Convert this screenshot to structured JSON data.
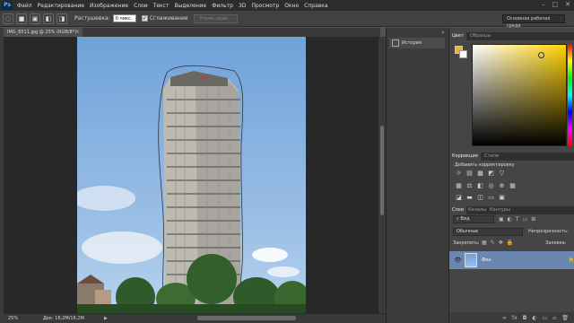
{
  "menu": {
    "logo": "Ps",
    "items": [
      "Файл",
      "Редактирование",
      "Изображение",
      "Слои",
      "Текст",
      "Выделение",
      "Фильтр",
      "3D",
      "Просмотр",
      "Окно",
      "Справка"
    ]
  },
  "options": {
    "feather_label": "Растушевка:",
    "feather_value": "0 пикс.",
    "antialias_label": "Сглаживание",
    "antialias_checked": true,
    "refine_edge": "Уточн. край...",
    "workspace": "Основная рабочая среда"
  },
  "document": {
    "tab_title": "IMG_8511.jpg @ 25% (RGB/8*)",
    "zoom": "25%",
    "doc_size": "Док: 16,2M/16,2M"
  },
  "history_panel": {
    "label": "История"
  },
  "color_panel": {
    "tabs": [
      "Цвет",
      "Образцы"
    ],
    "foreground": "#e6b441",
    "background": "#ffffff"
  },
  "adjustments_panel": {
    "tabs": [
      "Коррекция",
      "Стили"
    ],
    "title": "Добавить корректировку"
  },
  "layers_panel": {
    "tabs": [
      "Слои",
      "Каналы",
      "Контуры"
    ],
    "kind_filter": "Вид",
    "blend_mode": "Обычные",
    "opacity_label": "Непрозрачность:",
    "lock_label": "Закрепить:",
    "fill_label": "Заливка:",
    "layer_name": "Фон"
  }
}
